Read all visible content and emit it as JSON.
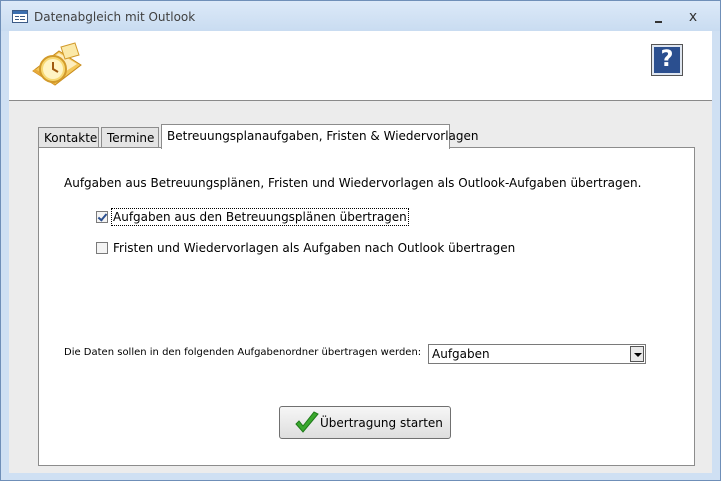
{
  "window": {
    "title": "Datenabgleich mit Outlook",
    "minimize_label": "",
    "close_label": "x"
  },
  "header": {
    "help_label": "?"
  },
  "tabs": [
    {
      "label": "Kontakte",
      "active": false
    },
    {
      "label": "Termine",
      "active": false
    },
    {
      "label": "Betreuungsplanaufgaben, Fristen & Wiedervorlagen",
      "active": true
    }
  ],
  "panel": {
    "intro": "Aufgaben aus Betreuungsplänen, Fristen und Wiedervorlagen als Outlook-Aufgaben übertragen.",
    "options": [
      {
        "label": "Aufgaben aus den Betreuungsplänen übertragen",
        "checked": true
      },
      {
        "label": "Fristen und Wiedervorlagen als Aufgaben nach Outlook übertragen",
        "checked": false
      }
    ],
    "folder_label": "Die Daten sollen in den folgenden Aufgabenordner übertragen werden:",
    "folder_value": "Aufgaben",
    "start_button": "Übertragung starten"
  },
  "colors": {
    "titlebar": "#cfe0f3",
    "accent": "#2b4f8f",
    "check_green": "#3aa82e"
  }
}
